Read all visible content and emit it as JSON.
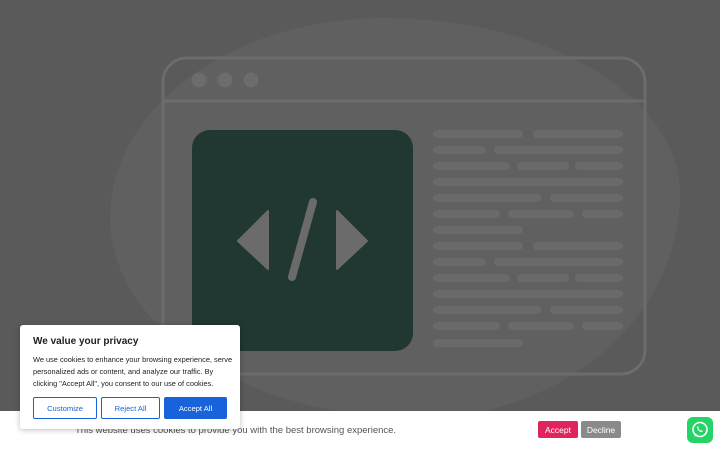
{
  "illustration": {
    "icon": "code-browser-illustration",
    "code_symbol": "</>"
  },
  "cookie_strip": {
    "message": "This website uses cookies to provide you with the best browsing experience.",
    "accept_label": "Accept",
    "decline_label": "Decline"
  },
  "consent_dialog": {
    "title": "We value your privacy",
    "body": "We use cookies to enhance your browsing experience, serve personalized ads or content, and analyze our traffic. By clicking \"Accept All\", you consent to our use of cookies.",
    "customize_label": "Customize",
    "reject_label": "Reject All",
    "accept_label": "Accept All"
  },
  "whatsapp": {
    "icon": "whatsapp-icon"
  },
  "colors": {
    "primary": "#1863dc",
    "accept_strip": "#e0245e",
    "decline_strip": "#8a8a8a",
    "whatsapp": "#25d366"
  }
}
